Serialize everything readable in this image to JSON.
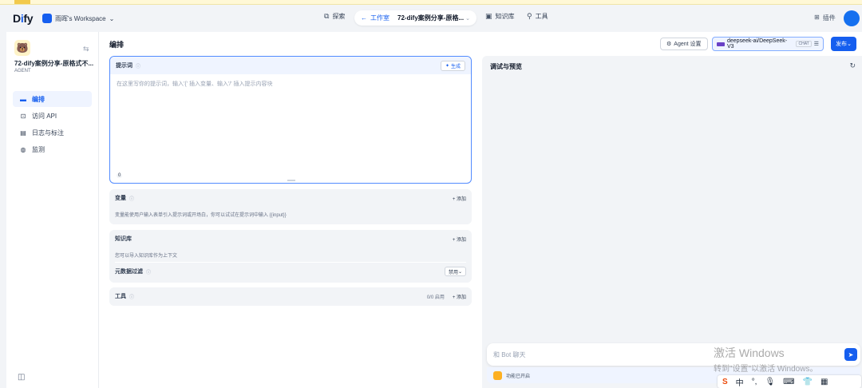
{
  "header": {
    "logo": "Dify",
    "workspace": "雨晖's Workspace",
    "explore_label": "探索",
    "studio_label": "工作室",
    "current_app": "72-dify案例分享-原格...",
    "knowledge_label": "知识库",
    "tools_label": "工具",
    "plugins_label": "插件"
  },
  "sidebar": {
    "app_name": "72-dify案例分享-原格式不...",
    "app_type": "AGENT",
    "items": [
      {
        "label": "编排",
        "icon": "orchestrate-icon",
        "active": true
      },
      {
        "label": "访问 API",
        "icon": "terminal-icon",
        "active": false
      },
      {
        "label": "日志与标注",
        "icon": "log-icon",
        "active": false
      },
      {
        "label": "监测",
        "icon": "monitor-icon",
        "active": false
      }
    ]
  },
  "toolbar": {
    "page_title": "编排",
    "agent_settings": "Agent 设置",
    "model_name": "deepseek-ai/DeepSeek-V3",
    "model_mode": "CHAT",
    "publish": "发布"
  },
  "prompt": {
    "label": "提示词",
    "generate": "生成",
    "placeholder": "在这里写你的提示词，输入'{' 插入变量、输入'/' 插入提示内容块",
    "char_count": "0"
  },
  "variables": {
    "label": "变量",
    "add": "+ 添加",
    "description": "变量能使用户输入表单引入提示词或开场白，你可以试试在提示词中输入 {{input}}"
  },
  "knowledge": {
    "label": "知识库",
    "add": "+ 添加",
    "description": "您可以导入知识库作为上下文",
    "metadata_filter": "元数据过滤",
    "metadata_value": "禁用"
  },
  "tools": {
    "label": "工具",
    "enabled": "0/0 启用",
    "add": "+ 添加"
  },
  "preview": {
    "title": "调试与预览",
    "chat_placeholder": "和 Bot 聊天",
    "feature_label": "功能已开启"
  },
  "watermark": {
    "line1": "激活 Windows",
    "line2": "转到\"设置\"以激活 Windows。"
  },
  "ime": {
    "s": "S",
    "lang": "中"
  }
}
